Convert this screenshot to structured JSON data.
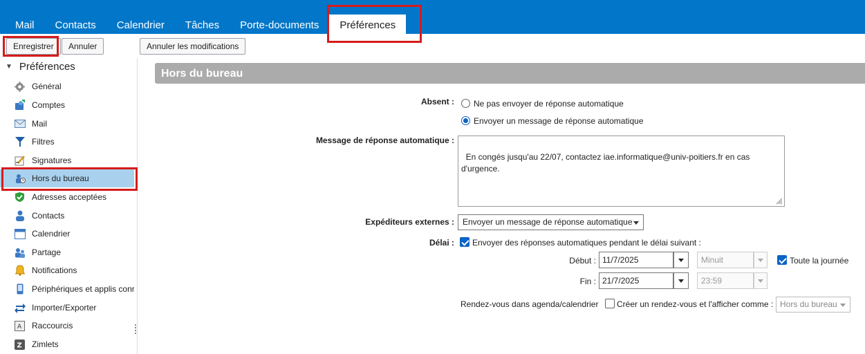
{
  "app_tabs": [
    {
      "label": "Mail"
    },
    {
      "label": "Contacts"
    },
    {
      "label": "Calendrier"
    },
    {
      "label": "Tâches"
    },
    {
      "label": "Porte-documents"
    },
    {
      "label": "Préférences",
      "active": true
    }
  ],
  "toolbar": {
    "save_label": "Enregistrer",
    "cancel_label": "Annuler",
    "undo_label": "Annuler les modifications"
  },
  "sidebar": {
    "root_label": "Préférences",
    "items": [
      {
        "label": "Général",
        "icon": "gear-icon"
      },
      {
        "label": "Comptes",
        "icon": "accounts-icon"
      },
      {
        "label": "Mail",
        "icon": "envelope-icon"
      },
      {
        "label": "Filtres",
        "icon": "filter-icon"
      },
      {
        "label": "Signatures",
        "icon": "signature-icon"
      },
      {
        "label": "Hors du bureau",
        "icon": "out-of-office-icon",
        "selected": true
      },
      {
        "label": "Adresses acceptées",
        "icon": "shield-check-icon"
      },
      {
        "label": "Contacts",
        "icon": "person-icon"
      },
      {
        "label": "Calendrier",
        "icon": "calendar-icon"
      },
      {
        "label": "Partage",
        "icon": "share-icon"
      },
      {
        "label": "Notifications",
        "icon": "bell-icon"
      },
      {
        "label": "Périphériques et applis conr",
        "icon": "device-icon"
      },
      {
        "label": "Importer/Exporter",
        "icon": "import-export-icon"
      },
      {
        "label": "Raccourcis",
        "icon": "shortcut-icon"
      },
      {
        "label": "Zimlets",
        "icon": "zimlet-icon"
      }
    ]
  },
  "main": {
    "section_title": "Hors du bureau",
    "absent_label": "Absent :",
    "radio_no_reply": "Ne pas envoyer de réponse automatique",
    "radio_send_reply": "Envoyer un message de réponse automatique",
    "radio_selected": "send_reply",
    "message_label": "Message de réponse automatique :",
    "message_value": "En congés jusqu'au 22/07, contactez iae.informatique@univ-poitiers.fr en cas\nd'urgence.",
    "external_label": "Expéditeurs externes :",
    "external_value": "Envoyer un message de réponse automatique",
    "delay_label": "Délai :",
    "delay_checkbox": "Envoyer des réponses automatiques pendant le délai suivant :",
    "delay_checked": true,
    "start_label": "Début :",
    "start_date": "11/7/2025",
    "start_time": "Minuit",
    "all_day_label": "Toute la journée",
    "all_day_checked": true,
    "end_label": "Fin :",
    "end_date": "21/7/2025",
    "end_time": "23:59",
    "appointment_label": "Rendez-vous dans agenda/calendrier",
    "appointment_checkbox": "Créer un rendez-vous et l'afficher comme :",
    "appointment_checked": false,
    "appointment_show_as": "Hors du bureau"
  },
  "colors": {
    "app_bar": "#0277c9",
    "selection": "#a9d1ee",
    "highlight_box": "#d61b1b",
    "section_header": "#ababab"
  }
}
